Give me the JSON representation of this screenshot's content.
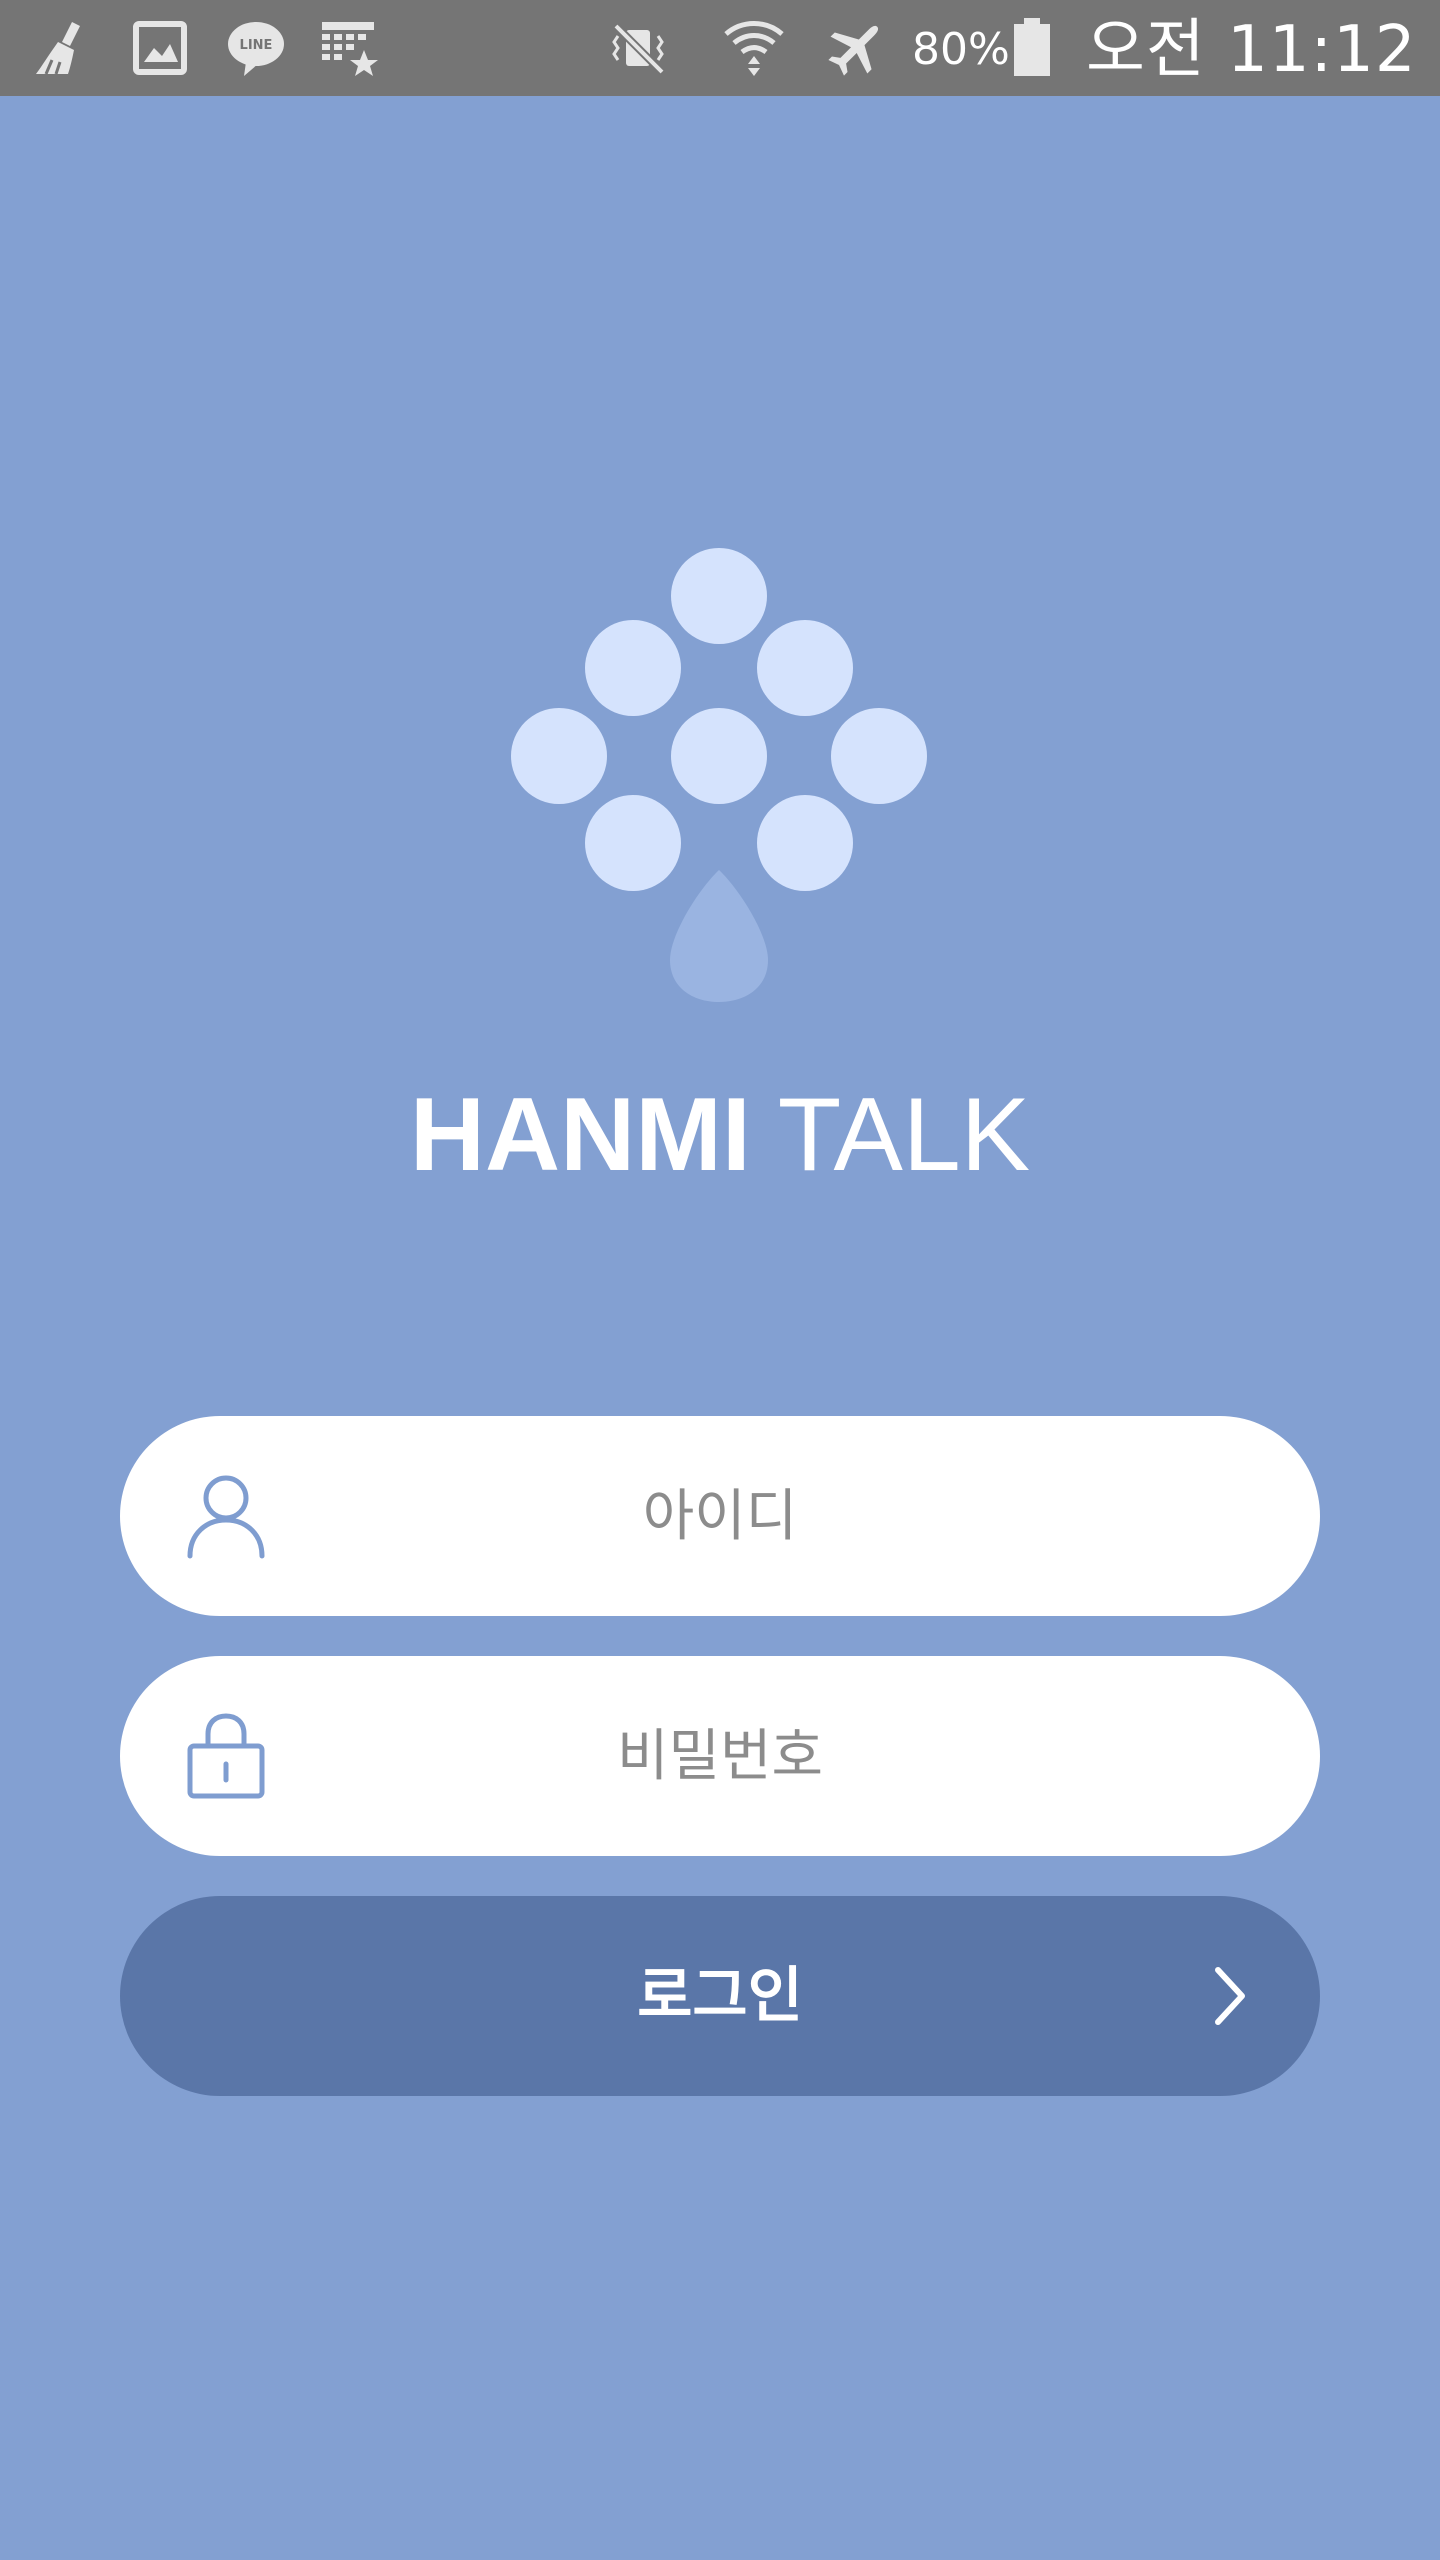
{
  "status_bar": {
    "notification_icons": [
      "cleaner-broom-icon",
      "image-icon",
      "line-app-icon",
      "calendar-star-icon"
    ],
    "system_icons": [
      "vibrate-mute-icon",
      "wifi-icon",
      "airplane-mode-icon",
      "battery-icon"
    ],
    "battery_percent": "80%",
    "clock": "오전 11:12"
  },
  "app": {
    "title_bold": "HANMI",
    "title_light": "TALK"
  },
  "login_form": {
    "id_placeholder": "아이디",
    "id_value": "",
    "password_placeholder": "비밀번호",
    "password_value": "",
    "login_label": "로그인"
  },
  "colors": {
    "background": "#83a0d2",
    "status_bar": "#757575",
    "logo_dots": "#d5e3fd",
    "logo_drop": "#9ab4e1",
    "field_background": "#ffffff",
    "field_icon": "#7f9dd0",
    "placeholder_text": "#8c8c8c",
    "login_button": "#5a76a8",
    "text_light": "#ffffff"
  }
}
